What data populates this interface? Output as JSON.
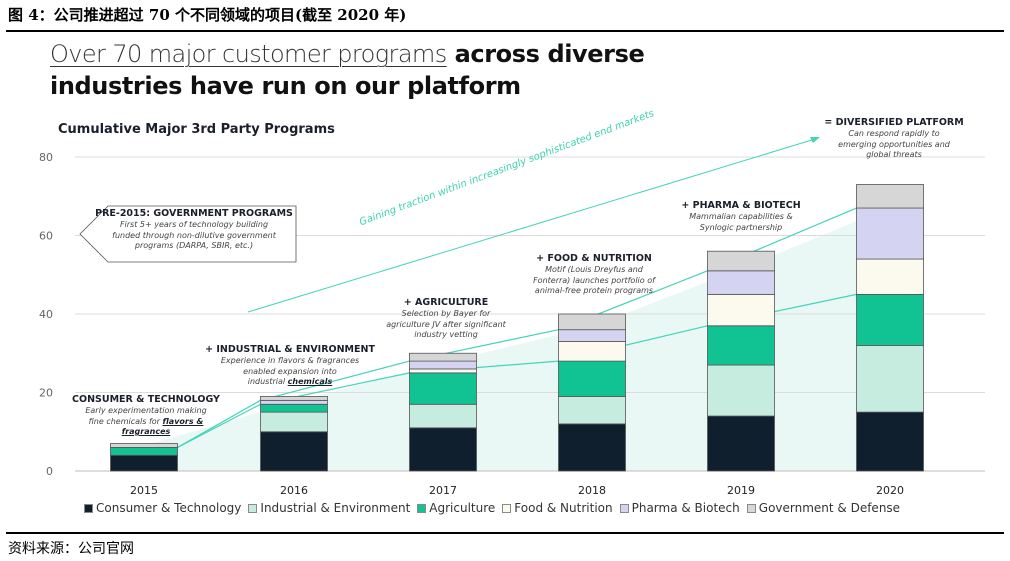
{
  "caption": "图 4：公司推进超过 70 个不同领域的项目(截至 2020 年)",
  "source": "资料来源：公司官网",
  "headline": {
    "light": "Over 70 major customer programs",
    "bold1": " across diverse",
    "bold2": "industries have run on our platform"
  },
  "trend_label": "Gaining traction within increasingly sophisticated end markets",
  "annotations": {
    "pre2015": {
      "title": "PRE-2015: GOVERNMENT PROGRAMS",
      "l1": "First 5+ years of technology building",
      "l2": "funded through non-dilutive government",
      "l3": "programs (DARPA, SBIR, etc.)"
    },
    "y2015": {
      "title": "CONSUMER & TECHNOLOGY",
      "l1": "Early experimentation making",
      "l2a": "fine chemicals for ",
      "l2b": "flavors &",
      "l3": "fragrances"
    },
    "y2016": {
      "title": "+ INDUSTRIAL & ENVIRONMENT",
      "l1": "Experience in flavors & fragrances",
      "l2": "enabled expansion into",
      "l3a": "industrial ",
      "l3b": "chemicals"
    },
    "y2017": {
      "title": "+ AGRICULTURE",
      "l1": "Selection by Bayer for",
      "l2": "agriculture JV after significant",
      "l3": "industry vetting"
    },
    "y2018": {
      "title": "+ FOOD & NUTRITION",
      "l1": "Motif (Louis Dreyfus and",
      "l2": "Fonterra) launches portfolio of",
      "l3": "animal-free protein programs"
    },
    "y2019": {
      "title": "+ PHARMA & BIOTECH",
      "l1": "Mammalian capabilities &",
      "l2": "Synlogic partnership"
    },
    "y2020": {
      "title": "= DIVERSIFIED PLATFORM",
      "l1": "Can respond rapidly to",
      "l2": "emerging opportunities and",
      "l3": "global threats"
    }
  },
  "colors": {
    "Consumer & Technology": "#0f1f2e",
    "Industrial & Environment": "#c6ece0",
    "Agriculture": "#11c393",
    "Food & Nutrition": "#fcfaef",
    "Pharma & Biotech": "#d4d3f1",
    "Government & Defense": "#d6d6d6",
    "line": "#44d4b8",
    "area": "#e2f6f0"
  },
  "chart_data": {
    "type": "bar",
    "stacked": true,
    "title": "Cumulative Major 3rd Party Programs",
    "categories": [
      "2015",
      "2016",
      "2017",
      "2018",
      "2019",
      "2020"
    ],
    "ylim": [
      0,
      80
    ],
    "yticks": [
      0,
      20,
      40,
      60,
      80
    ],
    "grid": true,
    "legend_position": "bottom",
    "series": [
      {
        "name": "Consumer & Technology",
        "values": [
          4,
          10,
          11,
          12,
          14,
          15
        ]
      },
      {
        "name": "Industrial & Environment",
        "values": [
          0,
          5,
          6,
          7,
          13,
          17
        ]
      },
      {
        "name": "Agriculture",
        "values": [
          2,
          2,
          8,
          9,
          10,
          13
        ]
      },
      {
        "name": "Food & Nutrition",
        "values": [
          0,
          0,
          1,
          5,
          8,
          9
        ]
      },
      {
        "name": "Pharma & Biotech",
        "values": [
          0,
          1,
          2,
          3,
          6,
          13
        ]
      },
      {
        "name": "Government & Defense",
        "values": [
          1,
          1,
          2,
          4,
          5,
          6
        ]
      }
    ]
  }
}
